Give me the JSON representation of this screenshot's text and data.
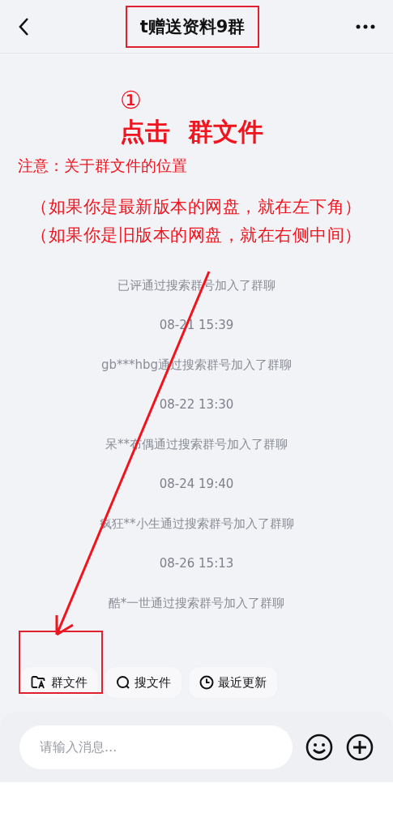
{
  "header": {
    "title": "t赠送资料9群",
    "highlighted": true
  },
  "annotation": {
    "step": "①",
    "instruction": "点击  群文件",
    "note": "注意：关于群文件的位置",
    "hints": [
      "（如果你是最新版本的网盘，就在左下角）",
      "（如果你是旧版本的网盘，就在右侧中间）"
    ]
  },
  "messages": [
    {
      "kind": "notice",
      "text": "已评通过搜索群号加入了群聊"
    },
    {
      "kind": "time",
      "text": "08-21 15:39"
    },
    {
      "kind": "notice",
      "text": "gb***hbg通过搜索群号加入了群聊"
    },
    {
      "kind": "time",
      "text": "08-22 13:30"
    },
    {
      "kind": "notice",
      "text": "呆**布偶通过搜索群号加入了群聊"
    },
    {
      "kind": "time",
      "text": "08-24 19:40"
    },
    {
      "kind": "notice",
      "text": "疯狂**小生通过搜索群号加入了群聊"
    },
    {
      "kind": "time",
      "text": "08-26 15:13"
    },
    {
      "kind": "notice",
      "text": "酷*一世通过搜索群号加入了群聊"
    }
  ],
  "quick_actions": [
    {
      "kind": "folder",
      "label": "群文件",
      "highlighted": true
    },
    {
      "kind": "search",
      "label": "搜文件",
      "highlighted": false
    },
    {
      "kind": "clock",
      "label": "最近更新",
      "highlighted": false
    }
  ],
  "composer": {
    "placeholder": "请输入消息..."
  }
}
